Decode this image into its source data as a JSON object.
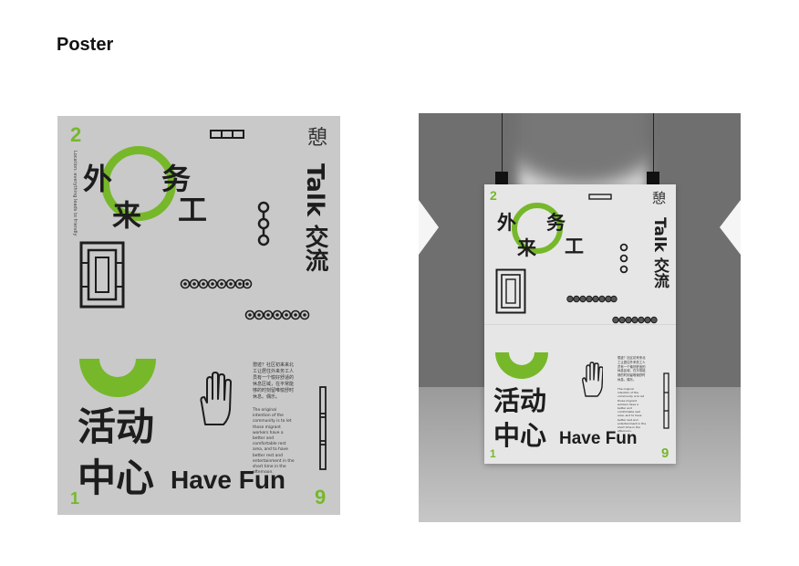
{
  "heading": "Poster",
  "poster": {
    "num_top": "2",
    "num_bottom_left": "1",
    "num_bottom_right": "9",
    "chars": [
      "外",
      "务",
      "来",
      "工"
    ],
    "vertical_label": "Talk 交流",
    "side_vertical_small": "Location: everything leads to friendly",
    "title_line1": "活动",
    "title_line2": "中心",
    "have_fun": "Have Fun",
    "corner_glyph": "憩",
    "desc_cn": "憩迹？社区初来来北工让居住外来务工人员有一个愉好舒适的休息区域，在平常能够的时刻留唯愉舒时休息。偶乐。",
    "desc_en": "The original intention of the community is to let those migrant workers have a better and comfortable rest area, and to have better rest and entertainment in the short time in the afternoon.",
    "accent": "#76b82a",
    "background": "#c9c9c9"
  },
  "mockup": {
    "poster_background": "#e6e6e6"
  }
}
